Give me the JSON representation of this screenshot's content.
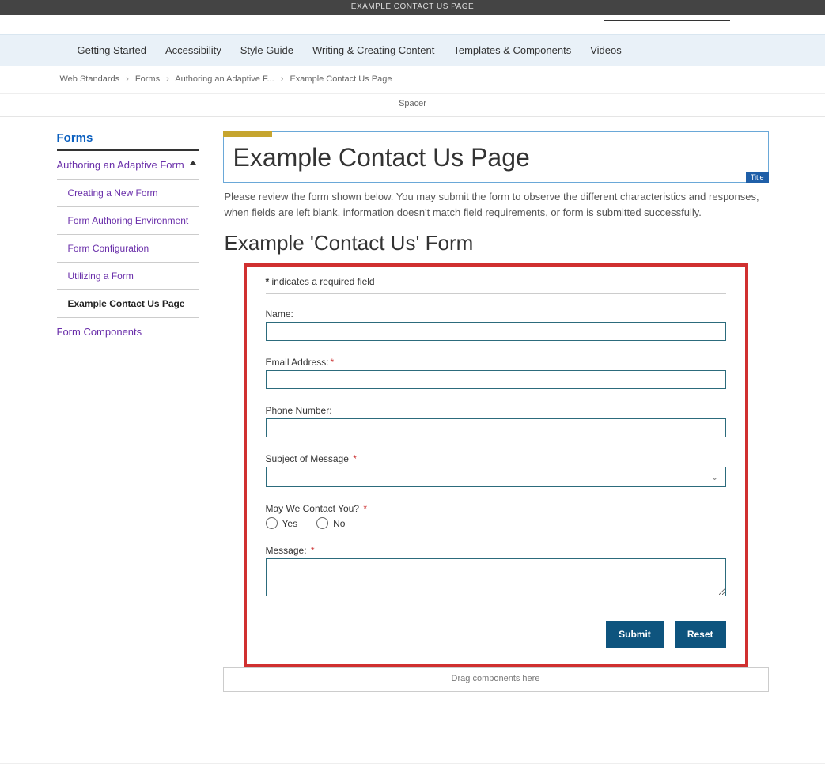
{
  "banner": {
    "text": "EXAMPLE CONTACT US PAGE"
  },
  "nav": {
    "items": [
      "Getting Started",
      "Accessibility",
      "Style Guide",
      "Writing & Creating Content",
      "Templates & Components",
      "Videos"
    ]
  },
  "breadcrumbs": {
    "items": [
      "Web Standards",
      "Forms",
      "Authoring an Adaptive F...",
      "Example Contact Us Page"
    ]
  },
  "spacer": {
    "label": "Spacer"
  },
  "sidebar": {
    "title": "Forms",
    "section": "Authoring an Adaptive Form",
    "subs": [
      {
        "label": "Creating a New Form",
        "active": false
      },
      {
        "label": "Form Authoring Environment",
        "active": false
      },
      {
        "label": "Form Configuration",
        "active": false
      },
      {
        "label": "Utilizing a Form",
        "active": false
      },
      {
        "label": "Example Contact Us Page",
        "active": true
      }
    ],
    "extra": "Form Components"
  },
  "main": {
    "title": "Example Contact Us Page",
    "title_tag": "Title",
    "intro": "Please review the form shown below. You may submit the form to observe the different characteristics and responses, when fields are left blank, information doesn't match field requirements, or form is submitted successfully.",
    "subheading": "Example 'Contact Us' Form"
  },
  "form": {
    "required_hint_prefix": "*",
    "required_hint_text": " indicates a required field",
    "name_label": "Name:",
    "email_label": "Email Address:",
    "phone_label": "Phone Number:",
    "subject_label": "Subject of Message",
    "contact_label": "May We Contact You?",
    "contact_yes": "Yes",
    "contact_no": "No",
    "message_label": "Message:",
    "submit": "Submit",
    "reset": "Reset"
  },
  "dropzone": {
    "label": "Drag components here"
  }
}
